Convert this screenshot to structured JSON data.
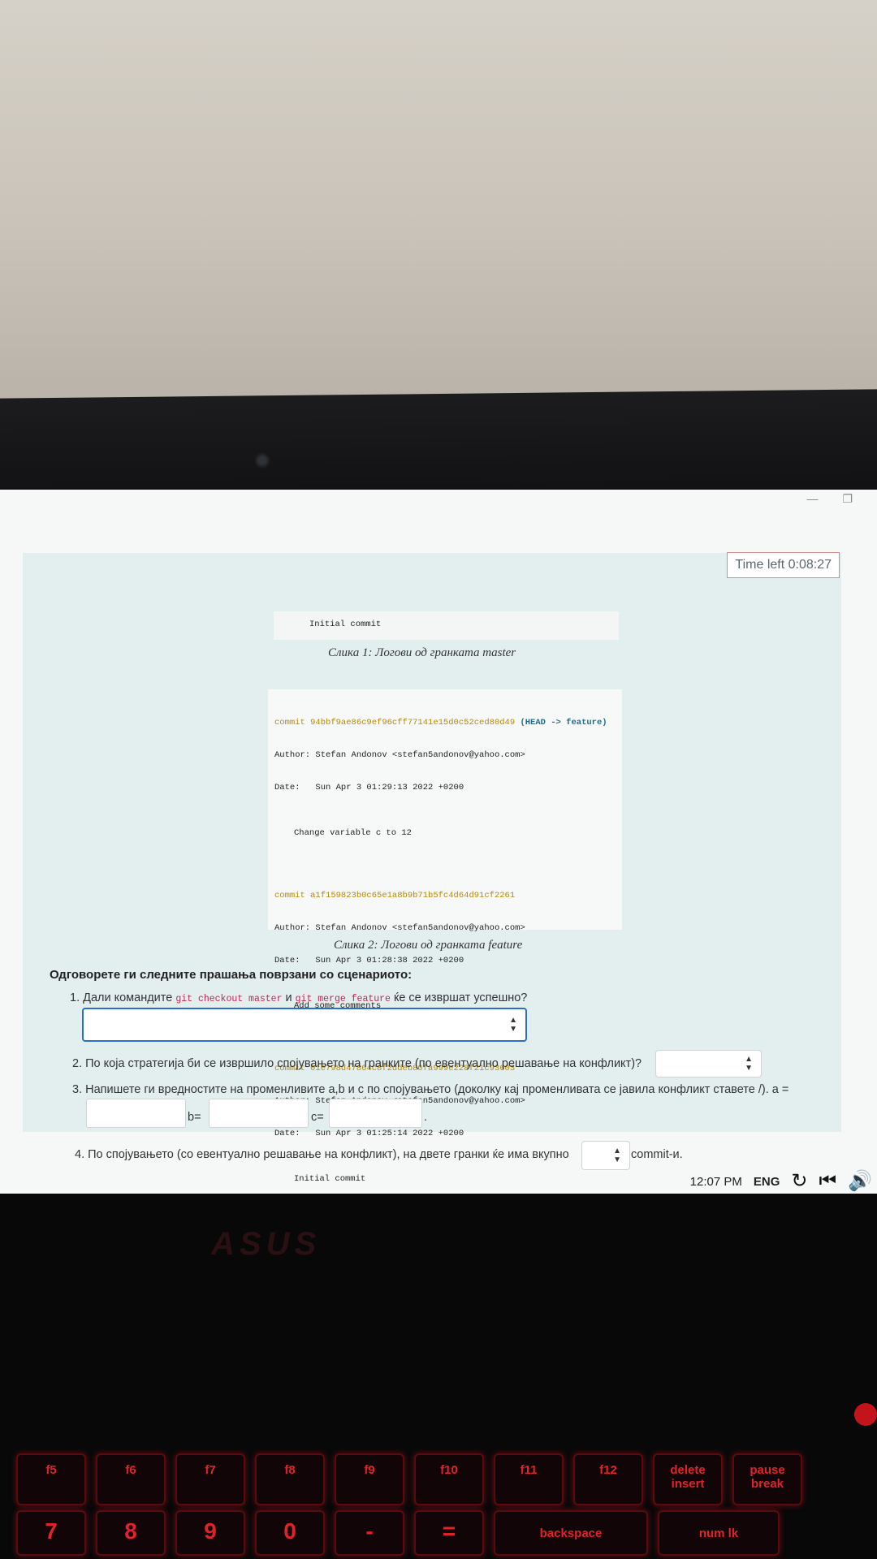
{
  "timer": {
    "text": "Time left 0:08:27"
  },
  "figure1": {
    "tail_line": "Initial commit",
    "caption": "Слика 1: Логови од гранката master"
  },
  "figure2": {
    "commits": [
      {
        "commit_prefix": "commit ",
        "hash": "94bbf9ae86c9ef96cff77141e15d0c52ced80d49",
        "ref": " (HEAD -> feature)",
        "author": "Author: Stefan Andonov <stefan5andonov@yahoo.com>",
        "date": "Date:   Sun Apr 3 01:29:13 2022 +0200",
        "message": "Change variable c to 12"
      },
      {
        "commit_prefix": "commit ",
        "hash": "a1f159823b0c65e1a8b9b71b5fc4d64d91cf2261",
        "ref": "",
        "author": "Author: Stefan Andonov <stefan5andonov@yahoo.com>",
        "date": "Date:   Sun Apr 3 01:28:38 2022 +0200",
        "message": "Add some comments"
      },
      {
        "commit_prefix": "commit ",
        "hash": "01e798d47864c8f2ddeb80fa999e228f21c93603",
        "ref": "",
        "author": "Author: Stefan Andonov <stefan5andonov@yahoo.com>",
        "date": "Date:   Sun Apr 3 01:25:14 2022 +0200",
        "message": "Initial commit"
      }
    ],
    "caption": "Слика 2: Логови од гранката feature"
  },
  "questions": {
    "heading": "Одговорете ги следните прашања поврзани со сценариото:",
    "q1": {
      "prefix": "1. Дали командите ",
      "code1": "git checkout master",
      "mid": " и ",
      "code2": "git merge feature",
      "suffix": " ќе се извршат успешно?",
      "value": ""
    },
    "q2": {
      "text": "2. По која стратегија би се извршило спојувањето на гранките (по евентуално решавање на конфликт)?",
      "value": ""
    },
    "q3": {
      "text": "3. Напишете ги вредностите на променливите a,b и c по спојувањето (доколку кај променливата се јавила конфликт ставете /). a =",
      "label_b": "b=",
      "label_c": "c=",
      "dot": ".",
      "value_a": "",
      "value_b": "",
      "value_c": ""
    },
    "q4": {
      "prefix": "4. По спојувањето (со евентуално решавање на конфликт), на двете гранки ќе има вкупно",
      "suffix": "commit-и.",
      "value": ""
    }
  },
  "taskbar": {
    "time": "12:07 PM",
    "lang": "ENG",
    "icons": [
      "refresh-icon",
      "skip-back-icon",
      "volume-icon"
    ]
  },
  "device": {
    "brand": "ASUS",
    "fn_keys": [
      "f5",
      "f6",
      "f7",
      "f8",
      "f9",
      "f10",
      "f11",
      "f12",
      "delete insert",
      "pause break"
    ],
    "num_keys": [
      "7",
      "8",
      "9",
      "0",
      "-",
      "=",
      "backspace",
      "num lk"
    ]
  }
}
